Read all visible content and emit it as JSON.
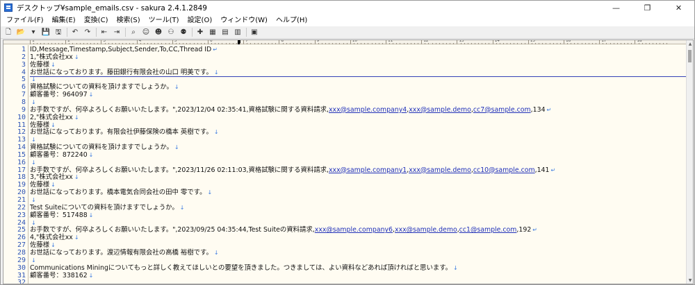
{
  "window": {
    "title": "デスクトップ¥sample_emails.csv - sakura 2.4.1.2849",
    "minimize_glyph": "—",
    "restore_glyph": "❐",
    "close_glyph": "✕"
  },
  "menu": [
    {
      "label": "ファイル(F)"
    },
    {
      "label": "編集(E)"
    },
    {
      "label": "変換(C)"
    },
    {
      "label": "検索(S)"
    },
    {
      "label": "ツール(T)"
    },
    {
      "label": "設定(O)"
    },
    {
      "label": "ウィンドウ(W)"
    },
    {
      "label": "ヘルプ(H)"
    }
  ],
  "toolbar_icons": [
    {
      "name": "new-file-icon",
      "glyph": "🗋"
    },
    {
      "name": "open-folder-icon",
      "glyph": "📂"
    },
    {
      "name": "dropdown-icon",
      "glyph": "▾"
    },
    {
      "name": "save-icon",
      "glyph": "💾"
    },
    {
      "name": "save-all-icon",
      "glyph": "🖫"
    },
    {
      "name": "sep"
    },
    {
      "name": "undo-icon",
      "glyph": "↶"
    },
    {
      "name": "redo-icon",
      "glyph": "↷"
    },
    {
      "name": "sep"
    },
    {
      "name": "jump-back-icon",
      "glyph": "⇤"
    },
    {
      "name": "jump-forward-icon",
      "glyph": "⇥"
    },
    {
      "name": "sep"
    },
    {
      "name": "search-icon",
      "glyph": "⌕"
    },
    {
      "name": "search-prev-icon",
      "glyph": "☺"
    },
    {
      "name": "search-next-icon",
      "glyph": "☻"
    },
    {
      "name": "replace-icon",
      "glyph": "⚇"
    },
    {
      "name": "grep-icon",
      "glyph": "⚉"
    },
    {
      "name": "sep"
    },
    {
      "name": "mark-icon",
      "glyph": "✚"
    },
    {
      "name": "bookmark-icon",
      "glyph": "▦"
    },
    {
      "name": "bookmark-prev-icon",
      "glyph": "▤"
    },
    {
      "name": "bookmark-next-icon",
      "glyph": "▥"
    },
    {
      "name": "sep"
    },
    {
      "name": "outline-icon",
      "glyph": "▣"
    }
  ],
  "ruler": {
    "labels": [
      "1",
      "2",
      "3",
      "4",
      "5",
      "6",
      "7",
      "8",
      "9",
      "10",
      "11",
      "12",
      "13",
      "14",
      "15",
      "16",
      "17",
      "18"
    ]
  },
  "lines": [
    {
      "no": "1",
      "parts": [
        {
          "t": "ID,Message,Timestamp,Subject,Sender,To,CC,Thread ID"
        }
      ],
      "eol": "↵"
    },
    {
      "no": "2",
      "parts": [
        {
          "t": "1,\"株式会社xx"
        }
      ],
      "eol": "↓"
    },
    {
      "no": "3",
      "parts": [
        {
          "t": "佐藤様"
        }
      ],
      "eol": "↓"
    },
    {
      "no": "4",
      "parts": [
        {
          "t": "お世話になっております。藤田銀行有限会社の山口 明美です。"
        }
      ],
      "eol": "↓"
    },
    {
      "no": "5",
      "parts": [
        {
          "t": ""
        }
      ],
      "eol": "↓"
    },
    {
      "no": "6",
      "parts": [
        {
          "t": "資格試験についての資料を頂けますでしょうか。"
        }
      ],
      "eol": "↓"
    },
    {
      "no": "7",
      "parts": [
        {
          "t": "顧客番号：964097"
        }
      ],
      "eol": "↓"
    },
    {
      "no": "8",
      "parts": [
        {
          "t": ""
        }
      ],
      "eol": "↓"
    },
    {
      "no": "9",
      "parts": [
        {
          "t": "お手数ですが、何卒よろしくお願いいたします。\",2023/12/04 02:35:41,資格試験に関する資料請求,"
        },
        {
          "t": "xxx@sample.company4",
          "link": true
        },
        {
          "t": ","
        },
        {
          "t": "xxx@sample.demo",
          "link": true
        },
        {
          "t": ","
        },
        {
          "t": "cc7@sample.com",
          "link": true
        },
        {
          "t": ",134"
        }
      ],
      "eol": "↵"
    },
    {
      "no": "10",
      "parts": [
        {
          "t": "2,\"株式会社xx"
        }
      ],
      "eol": "↓"
    },
    {
      "no": "11",
      "parts": [
        {
          "t": "佐藤様"
        }
      ],
      "eol": "↓"
    },
    {
      "no": "12",
      "parts": [
        {
          "t": "お世話になっております。有限会社伊藤保険の橋本 英樹です。"
        }
      ],
      "eol": "↓"
    },
    {
      "no": "13",
      "parts": [
        {
          "t": ""
        }
      ],
      "eol": "↓"
    },
    {
      "no": "14",
      "parts": [
        {
          "t": "資格試験についての資料を頂けますでしょうか。"
        }
      ],
      "eol": "↓"
    },
    {
      "no": "15",
      "parts": [
        {
          "t": "顧客番号：872240"
        }
      ],
      "eol": "↓"
    },
    {
      "no": "16",
      "parts": [
        {
          "t": ""
        }
      ],
      "eol": "↓"
    },
    {
      "no": "17",
      "parts": [
        {
          "t": "お手数ですが、何卒よろしくお願いいたします。\",2023/11/26 02:11:03,資格試験に関する資料請求,"
        },
        {
          "t": "xxx@sample.company1",
          "link": true
        },
        {
          "t": ","
        },
        {
          "t": "xxx@sample.demo",
          "link": true
        },
        {
          "t": ","
        },
        {
          "t": "cc10@sample.com",
          "link": true
        },
        {
          "t": ",141"
        }
      ],
      "eol": "↵"
    },
    {
      "no": "18",
      "parts": [
        {
          "t": "3,\"株式会社xx"
        }
      ],
      "eol": "↓"
    },
    {
      "no": "19",
      "parts": [
        {
          "t": "佐藤様"
        }
      ],
      "eol": "↓"
    },
    {
      "no": "20",
      "parts": [
        {
          "t": "お世話になっております。橋本電気合同会社の田中 零です。"
        }
      ],
      "eol": "↓"
    },
    {
      "no": "21",
      "parts": [
        {
          "t": ""
        }
      ],
      "eol": "↓"
    },
    {
      "no": "22",
      "parts": [
        {
          "t": "Test Suiteについての資料を頂けますでしょうか。"
        }
      ],
      "eol": "↓"
    },
    {
      "no": "23",
      "parts": [
        {
          "t": "顧客番号：517488"
        }
      ],
      "eol": "↓"
    },
    {
      "no": "24",
      "parts": [
        {
          "t": ""
        }
      ],
      "eol": "↓"
    },
    {
      "no": "25",
      "parts": [
        {
          "t": "お手数ですが、何卒よろしくお願いいたします。\",2023/09/25 04:35:44,Test Suiteの資料請求,"
        },
        {
          "t": "xxx@sample.company6",
          "link": true
        },
        {
          "t": ","
        },
        {
          "t": "xxx@sample.demo",
          "link": true
        },
        {
          "t": ","
        },
        {
          "t": "cc1@sample.com",
          "link": true
        },
        {
          "t": ",192"
        }
      ],
      "eol": "↵"
    },
    {
      "no": "26",
      "parts": [
        {
          "t": "4,\"株式会社xx"
        }
      ],
      "eol": "↓"
    },
    {
      "no": "27",
      "parts": [
        {
          "t": "佐藤様"
        }
      ],
      "eol": "↓"
    },
    {
      "no": "28",
      "parts": [
        {
          "t": "お世話になっております。渡辺情報有限会社の高橋 裕樹です。"
        }
      ],
      "eol": "↓"
    },
    {
      "no": "29",
      "parts": [
        {
          "t": ""
        }
      ],
      "eol": "↓"
    },
    {
      "no": "30",
      "parts": [
        {
          "t": "Communications Miningについてもっと詳しく教えてほしいとの要望を頂きました。つきましては、よい資料などあれば頂ければと思います。"
        }
      ],
      "eol": "↓"
    },
    {
      "no": "31",
      "parts": [
        {
          "t": "顧客番号：338162"
        }
      ],
      "eol": "↓"
    },
    {
      "no": "32",
      "parts": [
        {
          "t": ""
        }
      ],
      "eol": ""
    }
  ],
  "colors": {
    "line_number": "#2b53b5",
    "link": "#1f2fb8",
    "eol_mark": "#3b7ae0",
    "editor_bg": "#fffcf2"
  }
}
